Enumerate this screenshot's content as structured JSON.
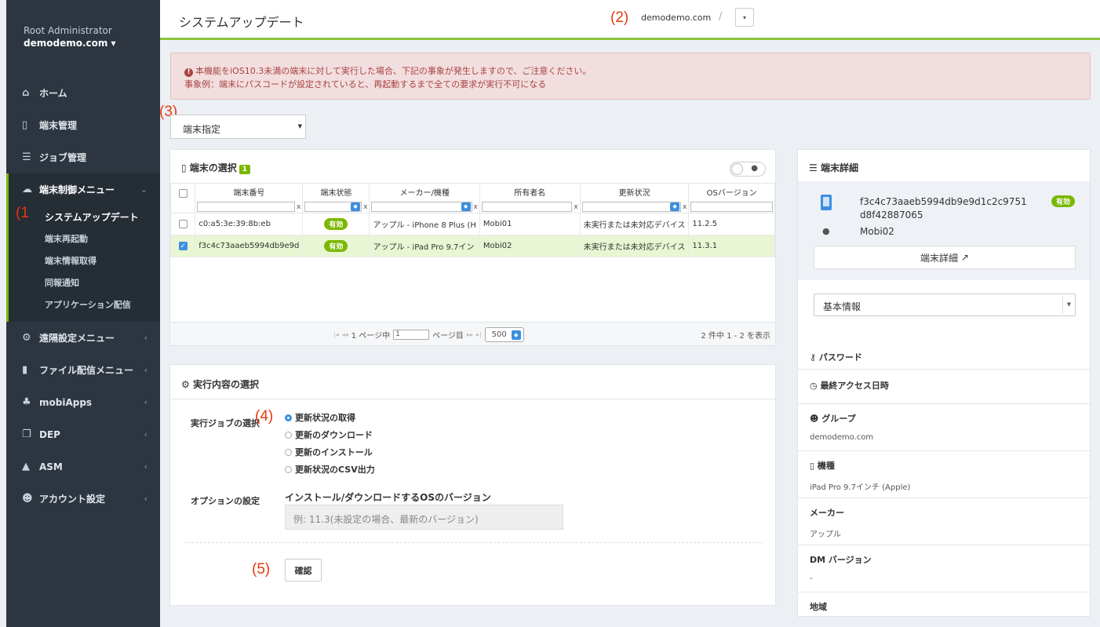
{
  "sidebar": {
    "role": "Root Administrator",
    "domain": "demodemo.com ▾",
    "items": [
      {
        "label": "ホーム",
        "icon": "home-icon"
      },
      {
        "label": "端末管理",
        "icon": "device-icon"
      },
      {
        "label": "ジョブ管理",
        "icon": "job-icon"
      }
    ],
    "open_menu": {
      "label": "端末制御メニュー",
      "chevron": "⌄",
      "subitems": [
        "システムアップデート",
        "端末再起動",
        "端末情報取得",
        "同報通知",
        "アプリケーション配信"
      ]
    },
    "items_after": [
      {
        "label": "遠隔設定メニュー",
        "icon": "gear-icon"
      },
      {
        "label": "ファイル配信メニュー",
        "icon": "file-icon"
      },
      {
        "label": "mobiApps",
        "icon": "apps-icon"
      },
      {
        "label": "DEP",
        "icon": "copy-icon"
      },
      {
        "label": "ASM",
        "icon": "graduation-icon"
      },
      {
        "label": "アカウント設定",
        "icon": "users-icon"
      }
    ],
    "chevron": "‹"
  },
  "annotations": {
    "a1": "(1",
    "a2": "(2)",
    "a3": "(3)",
    "a4": "(4)",
    "a5": "(5)"
  },
  "topbar": {
    "title": "システムアップデート",
    "domain": "demodemo.com",
    "separator": "/",
    "dropdown": "▾"
  },
  "alert": {
    "line1": "本機能をiOS10.3未満の端末に対して実行した場合、下記の事象が発生しますので、ご注意ください。",
    "line2": "事象例：端末にパスコードが設定されていると、再起動するまで全ての要求が実行不可になる"
  },
  "target_select": {
    "value": "端末指定"
  },
  "device_select": {
    "title": "端末の選択",
    "count": "1",
    "columns": [
      "端末番号",
      "端末状態",
      "メーカー/機種",
      "所有者名",
      "更新状況",
      "OSバージョン"
    ],
    "filter_x": "x",
    "rows": [
      {
        "checked": false,
        "id": "c0:a5:3e:39:8b:eb",
        "status": "有効",
        "model": "アップル - iPhone 8 Plus (H",
        "owner": "Mobi01",
        "update": "未実行または未対応デバイス",
        "os": "11.2.5"
      },
      {
        "checked": true,
        "id": "f3c4c73aaeb5994db9e9d",
        "status": "有効",
        "model": "アップル - iPad Pro 9.7イン",
        "owner": "Mobi02",
        "update": "未実行または未対応デバイス",
        "os": "11.3.1"
      }
    ],
    "pager": {
      "before": "1 ページ中",
      "page": "1",
      "after": "ページ目",
      "page_size": "500",
      "count": "2 件中 1 - 2 を表示"
    }
  },
  "exec": {
    "title": "実行内容の選択",
    "job_label": "実行ジョブの選択",
    "jobs": [
      "更新状況の取得",
      "更新のダウンロード",
      "更新のインストール",
      "更新状況のCSV出力"
    ],
    "selected_job": 0,
    "option_label": "オプションの設定",
    "option_title": "インストール/ダウンロードするOSのバージョン",
    "option_placeholder": "例: 11.3(未設定の場合、最新のバージョン)",
    "confirm": "確認"
  },
  "detail": {
    "title": "端末詳細",
    "device_id_1": "f3c4c73aaeb5994db9e9d1c2c9751",
    "device_id_2": "d8f42887065",
    "status": "有効",
    "owner": "Mobi02",
    "detail_button": "端末詳細",
    "info_select": "基本情報",
    "props": [
      {
        "key": "パスワード",
        "value": ""
      },
      {
        "key": "最終アクセス日時",
        "value": ""
      },
      {
        "key": "グループ",
        "value": "demodemo.com"
      },
      {
        "key": "機種",
        "value": "iPad Pro 9.7インチ (Apple)"
      },
      {
        "key": "メーカー",
        "value": "アップル"
      },
      {
        "key": "DM バージョン",
        "value": "-"
      },
      {
        "key": "地域",
        "value": ""
      }
    ]
  },
  "colors": {
    "accent": "#7ab800",
    "primary": "#3b8fe0",
    "annotation": "#e8380d",
    "sidebar": "#2d3640"
  }
}
